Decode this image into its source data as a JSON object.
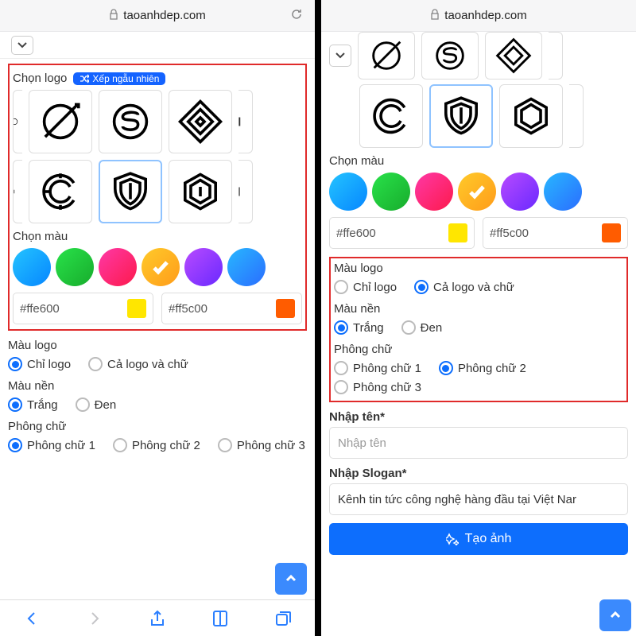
{
  "url": "taoanhdep.com",
  "left": {
    "chonlogo_label": "Chọn logo",
    "shuffle_label": "Xếp ngẫu nhiên",
    "chonmau_label": "Chọn màu",
    "hex1": "#ffe600",
    "hex2": "#ff5c00",
    "maulogo_label": "Màu logo",
    "opt_chilogo": "Chỉ logo",
    "opt_calogo": "Cả logo và chữ",
    "maunen_label": "Màu nền",
    "opt_trang": "Trắng",
    "opt_den": "Đen",
    "phongchu_label": "Phông chữ",
    "opt_p1": "Phông chữ 1",
    "opt_p2": "Phông chữ 2",
    "opt_p3": "Phông chữ 3"
  },
  "right": {
    "chonmau_label": "Chọn màu",
    "hex1": "#ffe600",
    "hex2": "#ff5c00",
    "maulogo_label": "Màu logo",
    "opt_chilogo": "Chỉ logo",
    "opt_calogo": "Cả logo và chữ",
    "maunen_label": "Màu nền",
    "opt_trang": "Trắng",
    "opt_den": "Đen",
    "phongchu_label": "Phông chữ",
    "opt_p1": "Phông chữ 1",
    "opt_p2": "Phông chữ 2",
    "opt_p3": "Phông chữ 3",
    "nhapten_label": "Nhập tên*",
    "nhapten_ph": "Nhập tên",
    "slogan_label": "Nhập Slogan*",
    "slogan_value": "Kênh tin tức công nghệ hàng đầu tại Việt Nar",
    "create_label": "Tạo ảnh"
  },
  "colors": {
    "chip1": "#ffe600",
    "chip2": "#ff5c00"
  }
}
